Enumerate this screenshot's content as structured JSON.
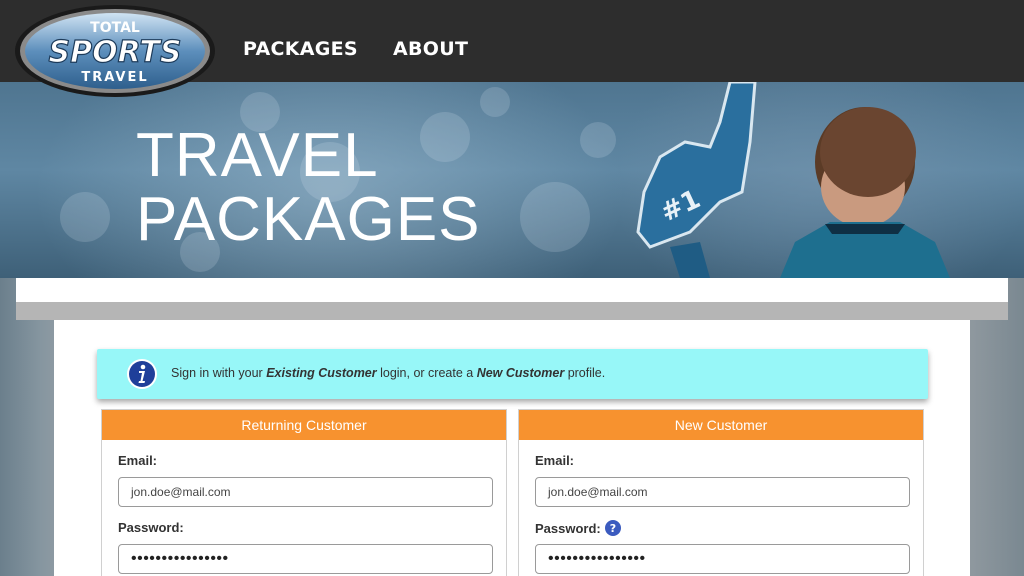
{
  "logo": {
    "line1": "TOTAL",
    "line2": "SPORTS",
    "line3": "TRAVEL"
  },
  "nav": {
    "packages": "PACKAGES",
    "about": "ABOUT"
  },
  "hero": {
    "title_line1": "TRAVEL",
    "title_line2": "PACKAGES"
  },
  "alert": {
    "text_before": "Sign in with your ",
    "existing": "Existing Customer",
    "text_middle": " login, or create a ",
    "new": "New Customer",
    "text_after": " profile."
  },
  "returning": {
    "header": "Returning Customer",
    "email_label": "Email:",
    "email_value": "jon.doe@mail.com",
    "password_label": "Password:",
    "password_value": "••••••••••••••••"
  },
  "new_customer": {
    "header": "New Customer",
    "email_label": "Email:",
    "email_value": "jon.doe@mail.com",
    "password_label": "Password:",
    "password_value": "••••••••••••••••"
  },
  "icons": {
    "info": "info-icon",
    "help": "question-icon"
  },
  "colors": {
    "accent_orange": "#f7922f",
    "alert_cyan": "#97f7f8",
    "topbar": "#2d2d2d"
  }
}
